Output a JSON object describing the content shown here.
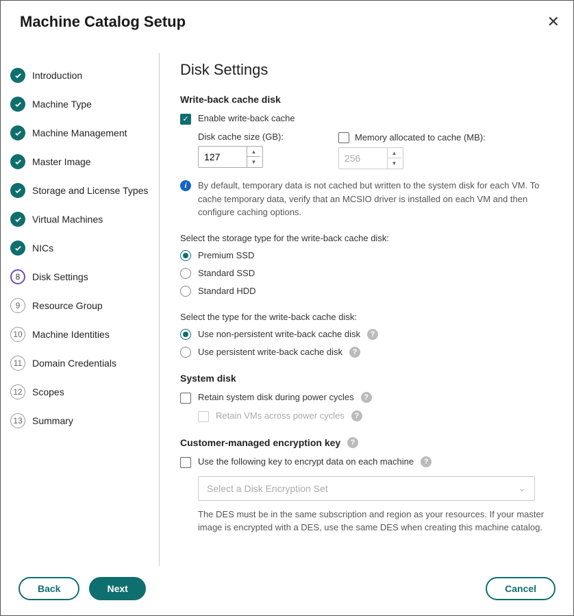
{
  "header": {
    "title": "Machine Catalog Setup"
  },
  "sidebar": {
    "steps": [
      {
        "label": "Introduction",
        "state": "done"
      },
      {
        "label": "Machine Type",
        "state": "done"
      },
      {
        "label": "Machine Management",
        "state": "done"
      },
      {
        "label": "Master Image",
        "state": "done"
      },
      {
        "label": "Storage and License Types",
        "state": "done"
      },
      {
        "label": "Virtual Machines",
        "state": "done"
      },
      {
        "label": "NICs",
        "state": "done"
      },
      {
        "label": "Disk Settings",
        "state": "current",
        "num": "8"
      },
      {
        "label": "Resource Group",
        "state": "pending",
        "num": "9"
      },
      {
        "label": "Machine Identities",
        "state": "pending",
        "num": "10"
      },
      {
        "label": "Domain Credentials",
        "state": "pending",
        "num": "11"
      },
      {
        "label": "Scopes",
        "state": "pending",
        "num": "12"
      },
      {
        "label": "Summary",
        "state": "pending",
        "num": "13"
      }
    ]
  },
  "main": {
    "title": "Disk Settings",
    "wb_section": "Write-back cache disk",
    "wb_enable": "Enable write-back cache",
    "wb_enable_checked": true,
    "disk_cache_label": "Disk cache size (GB):",
    "disk_cache_value": "127",
    "mem_cache_label": "Memory allocated to cache (MB):",
    "mem_cache_value": "256",
    "mem_cache_checked": false,
    "info_text": "By default, temporary data is not cached but written to the system disk for each VM. To cache temporary data, verify that an MCSIO driver is installed on each VM and then configure caching options.",
    "storage_type_label": "Select the storage type for the write-back cache disk:",
    "storage_options": [
      "Premium SSD",
      "Standard SSD",
      "Standard HDD"
    ],
    "storage_selected": 0,
    "disk_type_label": "Select the type for the write-back cache disk:",
    "disk_type_options": [
      "Use non-persistent write-back cache disk",
      "Use persistent write-back cache disk"
    ],
    "disk_type_selected": 0,
    "system_disk_section": "System disk",
    "retain_system": "Retain system disk during power cycles",
    "retain_system_checked": false,
    "retain_vms": "Retain VMs across power cycles",
    "retain_vms_disabled": true,
    "cmek_section": "Customer-managed encryption key",
    "cmek_checkbox": "Use the following key to encrypt data on each machine",
    "cmek_checked": false,
    "cmek_placeholder": "Select a Disk Encryption Set",
    "cmek_note": "The DES must be in the same subscription and region as your resources. If your master image is encrypted with a DES, use the same DES when creating this machine catalog."
  },
  "footer": {
    "back": "Back",
    "next": "Next",
    "cancel": "Cancel"
  }
}
